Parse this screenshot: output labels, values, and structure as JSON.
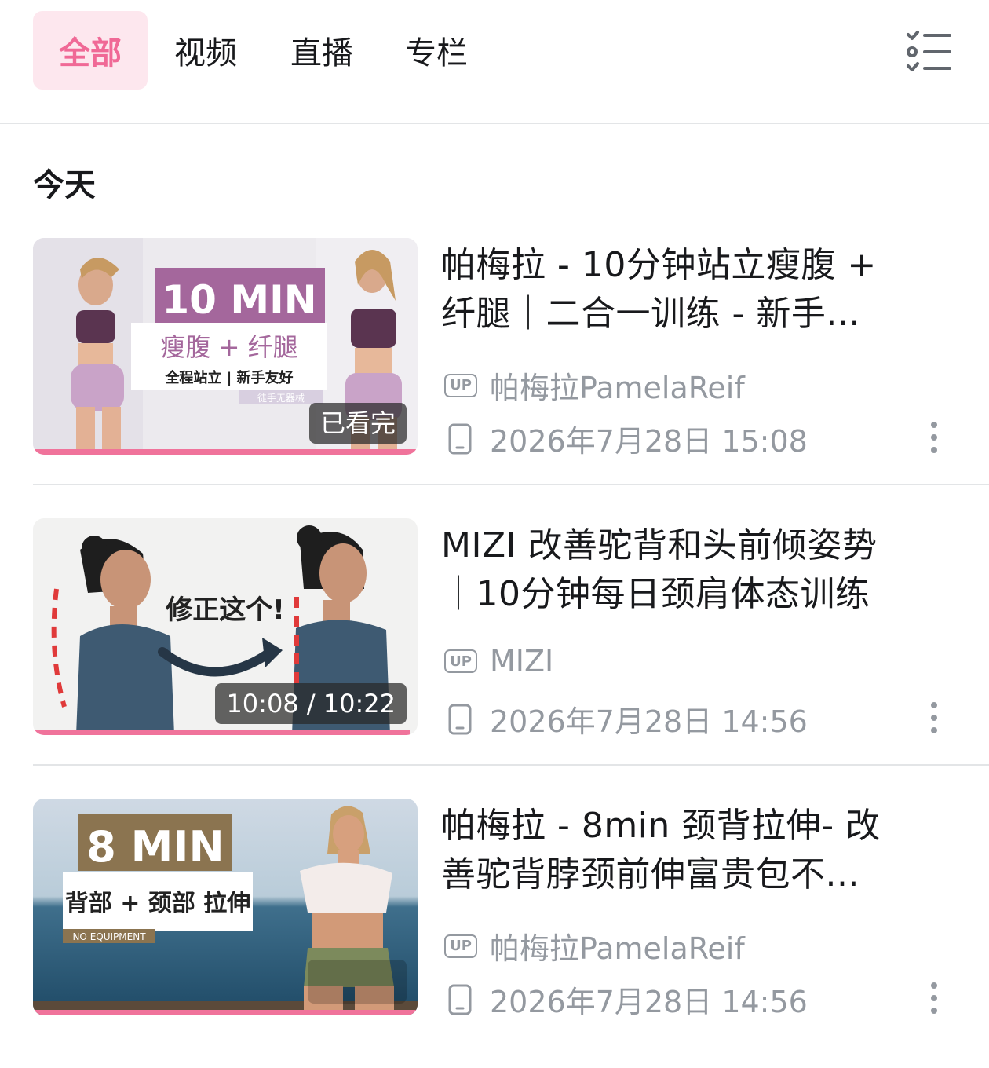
{
  "tabs": [
    {
      "label": "全部",
      "active": true
    },
    {
      "label": "视频",
      "active": false
    },
    {
      "label": "直播",
      "active": false
    },
    {
      "label": "专栏",
      "active": false
    }
  ],
  "menu_icon": "checklist-menu-icon",
  "section": {
    "title": "今天"
  },
  "items": [
    {
      "title": "帕梅拉 - 10分钟站立瘦腹 + 纤腿｜二合一训练 - 新手...",
      "uploader": "帕梅拉PamelaReif",
      "up_badge": "UP",
      "time": "2026年7月28日 15:08",
      "overlay": "已看完",
      "progress": 1.0,
      "device_icon": "phone-icon",
      "thumb": {
        "headline": "10 MIN",
        "sub": "瘦腹 + 纤腿",
        "caption": "全程站立 | 新手友好",
        "tag": "徒手无器械",
        "accent": "#a4679c"
      }
    },
    {
      "title": "MIZI 改善驼背和头前倾姿势｜10分钟每日颈肩体态训练",
      "uploader": "MIZI",
      "up_badge": "UP",
      "time": "2026年7月28日 14:56",
      "overlay": "10:08 / 10:22",
      "progress": 0.98,
      "device_icon": "phone-icon",
      "thumb": {
        "headline": "修正这个!"
      }
    },
    {
      "title": "帕梅拉 - 8min 颈背拉伸- 改善驼背脖颈前伸富贵包不...",
      "uploader": "帕梅拉PamelaReif",
      "up_badge": "UP",
      "time": "2026年7月28日 14:56",
      "overlay": "",
      "progress": 1.0,
      "device_icon": "phone-icon",
      "thumb": {
        "headline": "8 MIN",
        "sub": "背部 + 颈部 拉伸",
        "tag": "NO EQUIPMENT",
        "accent": "#8b7450"
      }
    }
  ],
  "colors": {
    "accent": "#f06996",
    "active_tab_bg": "#fde7ee",
    "progress": "#f0739b",
    "muted": "#9499a0"
  }
}
